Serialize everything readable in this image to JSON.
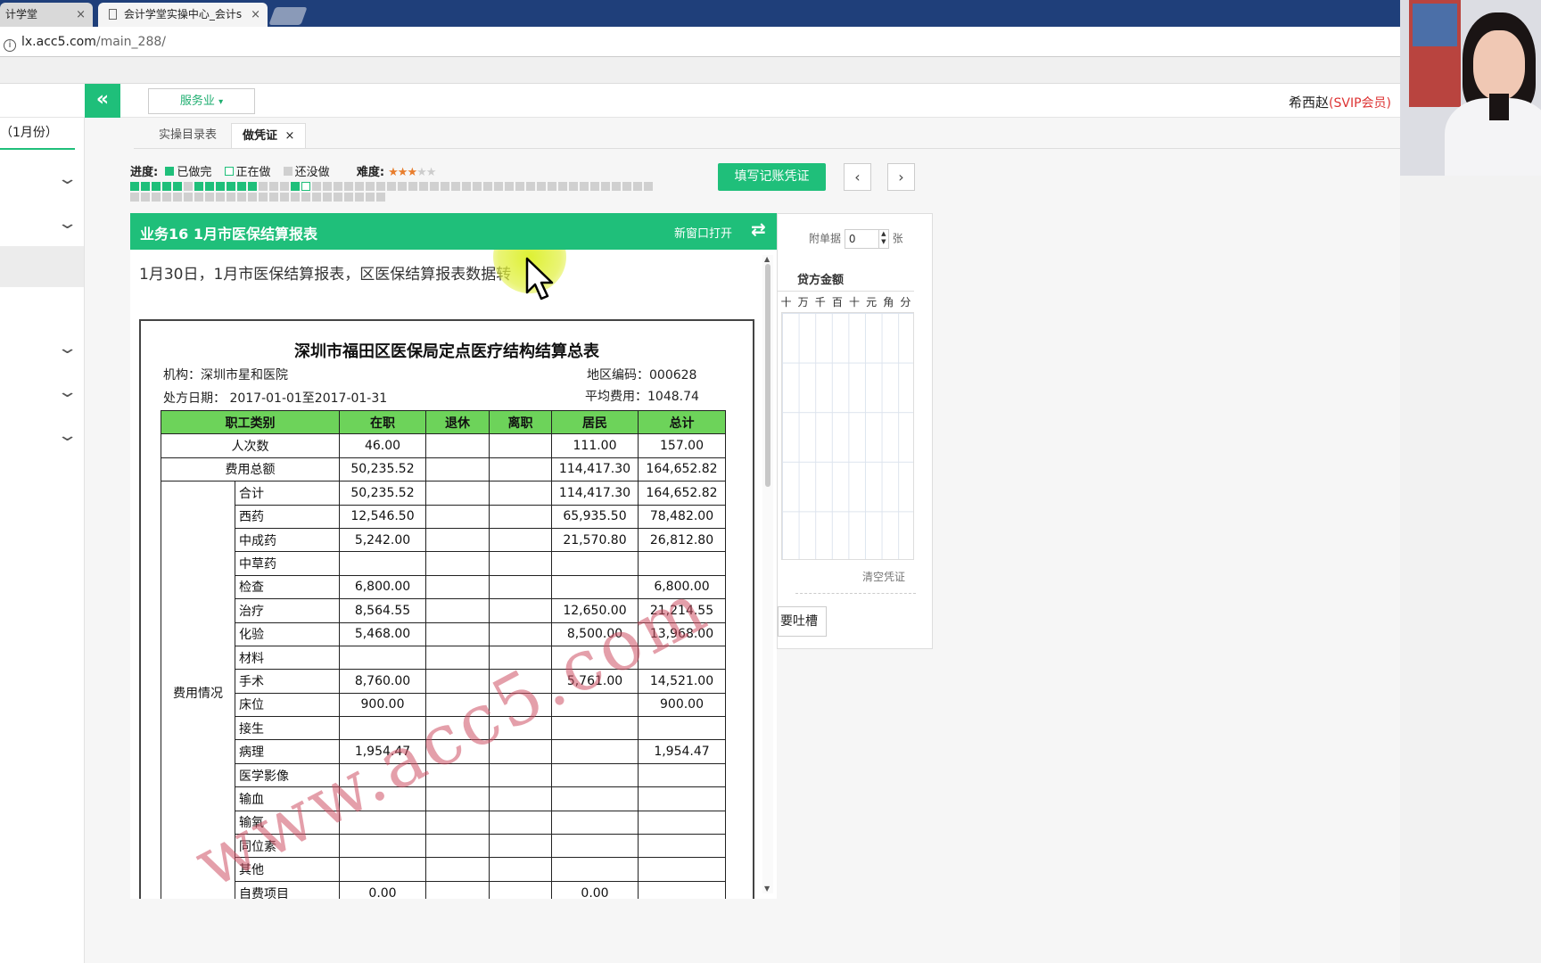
{
  "browser": {
    "tabs": [
      {
        "title": "计学堂",
        "close": "×"
      },
      {
        "title": "会计学堂实操中心_会计s",
        "close": "×"
      }
    ],
    "address": {
      "host": "lx.acc5.com",
      "path": "/main_288/"
    }
  },
  "header": {
    "collapse_icon": "«",
    "service_label": "服务业",
    "user_name": "希西赵",
    "user_level": "(SVIP会员)"
  },
  "sidebar": {
    "month_label": "（1月份）",
    "chevron": "⌄"
  },
  "tabs": [
    {
      "label": "实操目录表",
      "active": false
    },
    {
      "label": "做凭证",
      "active": true,
      "close": "×"
    }
  ],
  "progress": {
    "label": "进度:",
    "legend": [
      {
        "label": "已做完",
        "color": "#1fbf7a"
      },
      {
        "label": "正在做",
        "color": "#ffffff"
      },
      {
        "label": "还没做",
        "color": "#d0d0d0"
      }
    ],
    "difficulty_label": "难度:",
    "difficulty_stars": "★★★",
    "difficulty_empty": "★★",
    "done_count": 11,
    "doing_index": 16,
    "row1_total": 49,
    "row2_total": 24
  },
  "actions": {
    "fill_voucher": "填写记账凭证",
    "prev": "‹",
    "next": "›"
  },
  "task": {
    "title": "业务16 1月市医保结算报表",
    "open_new": "新窗口打开",
    "swap_icon": "⇄",
    "description": "1月30日，1月市医保结算报表，区医保结算报表数据转"
  },
  "report": {
    "title": "深圳市福田区医保局定点医疗结构结算总表",
    "org": "机构：深圳市星和医院",
    "region_code": "地区编码：000628",
    "date_range": "处方日期：  2017-01-01至2017-01-31",
    "avg_cost": "平均费用：1048.74",
    "headers": [
      "职工类别",
      "在职",
      "退休",
      "离职",
      "居民",
      "总计"
    ],
    "top_rows": [
      {
        "label": "人次数",
        "zaizhi": "46.00",
        "tuixiu": "",
        "lizhi": "",
        "jumin": "111.00",
        "total": "157.00"
      },
      {
        "label": "费用总额",
        "zaizhi": "50,235.52",
        "tuixiu": "",
        "lizhi": "",
        "jumin": "114,417.30",
        "total": "164,652.82"
      }
    ],
    "group_label": "费用情况",
    "detail_rows": [
      {
        "label": "合计",
        "zaizhi": "50,235.52",
        "tuixiu": "",
        "lizhi": "",
        "jumin": "114,417.30",
        "total": "164,652.82"
      },
      {
        "label": "西药",
        "zaizhi": "12,546.50",
        "tuixiu": "",
        "lizhi": "",
        "jumin": "65,935.50",
        "total": "78,482.00"
      },
      {
        "label": "中成药",
        "zaizhi": "5,242.00",
        "tuixiu": "",
        "lizhi": "",
        "jumin": "21,570.80",
        "total": "26,812.80"
      },
      {
        "label": "中草药",
        "zaizhi": "",
        "tuixiu": "",
        "lizhi": "",
        "jumin": "",
        "total": ""
      },
      {
        "label": "检查",
        "zaizhi": "6,800.00",
        "tuixiu": "",
        "lizhi": "",
        "jumin": "",
        "total": "6,800.00"
      },
      {
        "label": "治疗",
        "zaizhi": "8,564.55",
        "tuixiu": "",
        "lizhi": "",
        "jumin": "12,650.00",
        "total": "21,214.55"
      },
      {
        "label": "化验",
        "zaizhi": "5,468.00",
        "tuixiu": "",
        "lizhi": "",
        "jumin": "8,500.00",
        "total": "13,968.00"
      },
      {
        "label": "材料",
        "zaizhi": "",
        "tuixiu": "",
        "lizhi": "",
        "jumin": "",
        "total": ""
      },
      {
        "label": "手术",
        "zaizhi": "8,760.00",
        "tuixiu": "",
        "lizhi": "",
        "jumin": "5,761.00",
        "total": "14,521.00"
      },
      {
        "label": "床位",
        "zaizhi": "900.00",
        "tuixiu": "",
        "lizhi": "",
        "jumin": "",
        "total": "900.00"
      },
      {
        "label": "接生",
        "zaizhi": "",
        "tuixiu": "",
        "lizhi": "",
        "jumin": "",
        "total": ""
      },
      {
        "label": "病理",
        "zaizhi": "1,954.47",
        "tuixiu": "",
        "lizhi": "",
        "jumin": "",
        "total": "1,954.47"
      },
      {
        "label": "医学影像",
        "zaizhi": "",
        "tuixiu": "",
        "lizhi": "",
        "jumin": "",
        "total": ""
      },
      {
        "label": "输血",
        "zaizhi": "",
        "tuixiu": "",
        "lizhi": "",
        "jumin": "",
        "total": ""
      },
      {
        "label": "输氧",
        "zaizhi": "",
        "tuixiu": "",
        "lizhi": "",
        "jumin": "",
        "total": ""
      },
      {
        "label": "同位素",
        "zaizhi": "",
        "tuixiu": "",
        "lizhi": "",
        "jumin": "",
        "total": ""
      },
      {
        "label": "其他",
        "zaizhi": "",
        "tuixiu": "",
        "lizhi": "",
        "jumin": "",
        "total": ""
      },
      {
        "label": "自费项目",
        "zaizhi": "0.00",
        "tuixiu": "",
        "lizhi": "",
        "jumin": "0.00",
        "total": ""
      }
    ],
    "watermark": "www.acc5.com"
  },
  "voucher": {
    "attach_label": "附单据",
    "attach_value": "0",
    "attach_unit": "张",
    "credit_label": "贷方金额",
    "digit_units": [
      "十",
      "万",
      "千",
      "百",
      "十",
      "元",
      "角",
      "分"
    ],
    "clear_label": "清空凭证",
    "complain_label": "要吐槽"
  }
}
